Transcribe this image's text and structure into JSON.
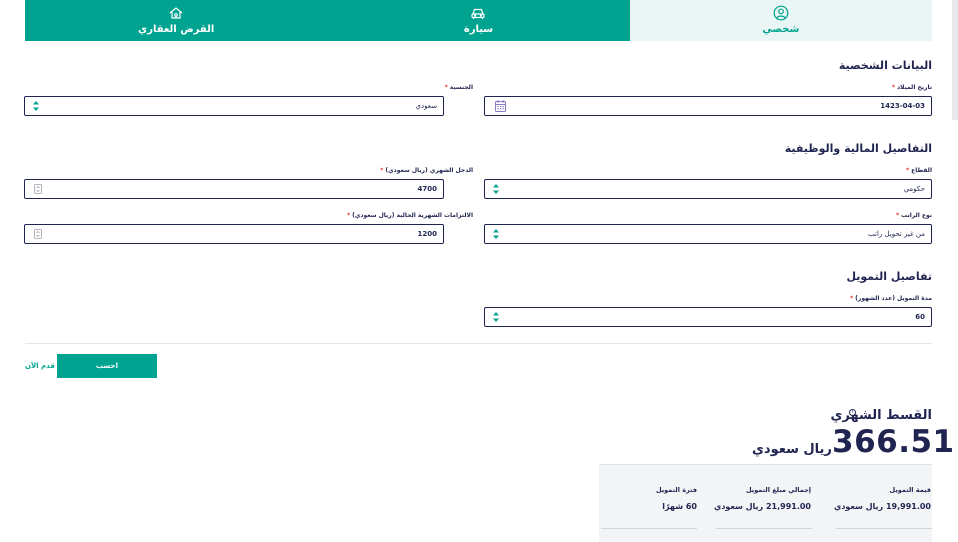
{
  "tabs": [
    {
      "label": "شخصي",
      "icon": "user-circle-icon",
      "active": true
    },
    {
      "label": "سيارة",
      "icon": "car-icon",
      "active": false
    },
    {
      "label": "القرض العقاري",
      "icon": "home-key-icon",
      "active": false
    }
  ],
  "personal": {
    "title": "البيانات الشخصية",
    "birth_label": "تاريخ الميلاد",
    "birth_value": "1423-04-03",
    "nationality_label": "الجنسية",
    "nationality_value": "سعودي"
  },
  "financial": {
    "title": "التفاصيل المالية والوظيفية",
    "sector_label": "القطاع",
    "sector_value": "حكومي",
    "income_label": "الدخل الشهري (ريال سعودي)",
    "income_value": "4700",
    "salary_type_label": "نوع الراتب",
    "salary_type_value": "من غير تحويل راتب",
    "obligations_label": "الالتزامات الشهرية الحالية (ريال سعودي)",
    "obligations_value": "1200"
  },
  "financing": {
    "title": "تفاصيل التمويل",
    "period_label": "مدة التمويل (عدد الشهور)",
    "period_value": "60"
  },
  "actions": {
    "calculate": "احسب",
    "apply": "قدم الآن"
  },
  "result": {
    "title": "القسط الشهري",
    "info": "i",
    "amount": "366.51",
    "currency": "ريال سعودي",
    "summary": [
      {
        "label": "قيمة التمويل",
        "value": "19,991.00 ريال سعودي"
      },
      {
        "label": "إجمالي مبلغ التمويل",
        "value": "21,991.00 ريال سعودي"
      },
      {
        "label": "فترة التمويل",
        "value": "60 شهرًا"
      }
    ]
  },
  "colors": {
    "brand": "#00a38f",
    "navy": "#1f2450",
    "required": "#e53935"
  }
}
